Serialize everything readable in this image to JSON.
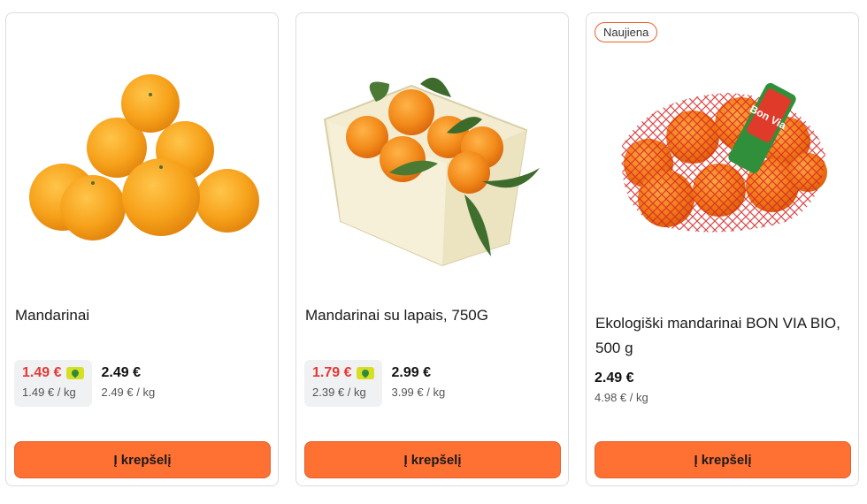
{
  "products": [
    {
      "title": "Mandarinai",
      "sale_price": "1.49 €",
      "sale_unit": "1.49 € / kg",
      "regular_price": "2.49 €",
      "regular_unit": "2.49 € / kg",
      "button": "Į krepšelį"
    },
    {
      "title": "Mandarinai su lapais, 750G",
      "sale_price": "1.79 €",
      "sale_unit": "2.39 € / kg",
      "regular_price": "2.99 €",
      "regular_unit": "3.99 € / kg",
      "button": "Į krepšelį"
    },
    {
      "badge": "Naujiena",
      "title": "Ekologiški mandarinai BON VIA BIO, 500 g",
      "regular_price": "2.49 €",
      "regular_unit": "4.98 € / kg",
      "button": "Į krepšelį",
      "bag_label": "Bon Via"
    }
  ],
  "icons": {
    "loyalty_card": "loyalty-card-icon"
  },
  "colors": {
    "accent": "#ff7033",
    "sale": "#e53935",
    "badge_border": "#e8632a"
  }
}
